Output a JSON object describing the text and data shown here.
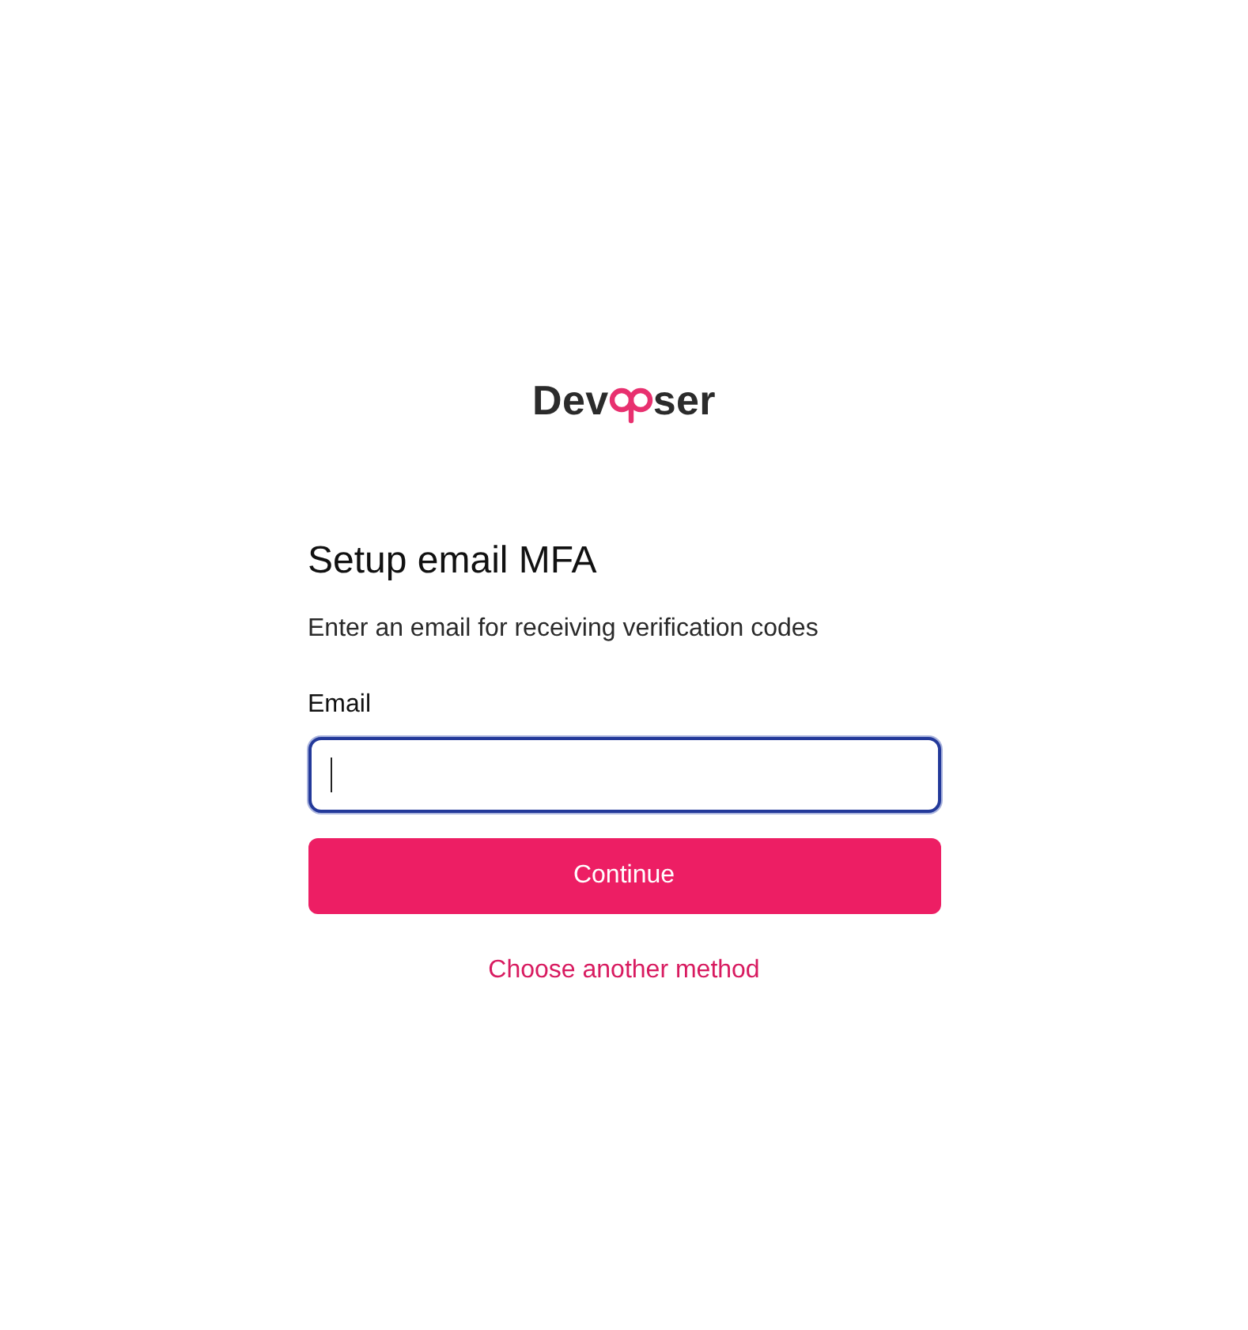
{
  "logo": {
    "prefix": "Dev",
    "suffix": "ser"
  },
  "form": {
    "title": "Setup email MFA",
    "subtitle": "Enter an email for receiving verification codes",
    "field": {
      "label": "Email",
      "focused": true
    },
    "submit": "Continue",
    "alternate_link": "Choose another method"
  }
}
